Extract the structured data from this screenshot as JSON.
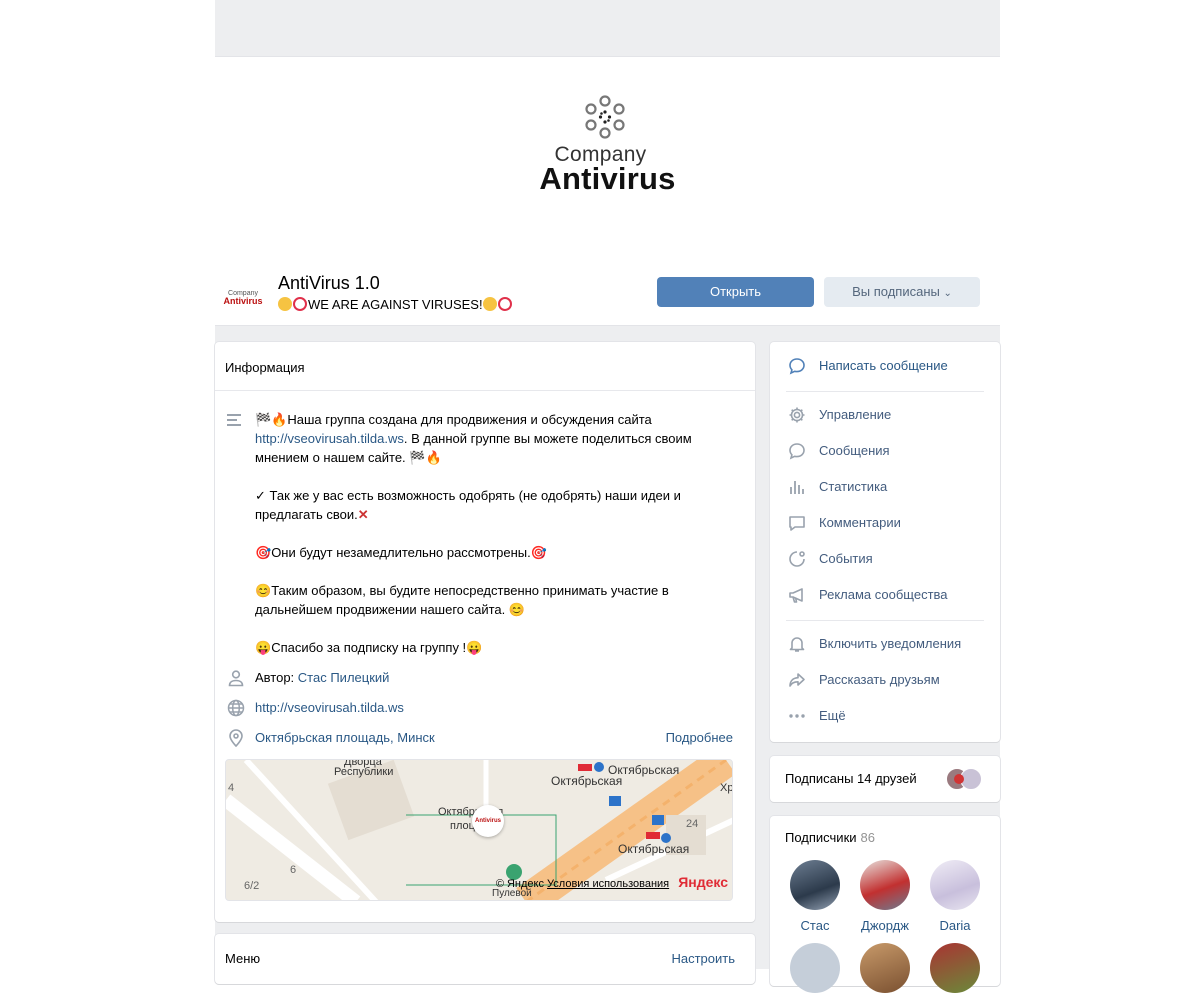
{
  "cover": {
    "company": "Company",
    "antivirus": "Antivirus"
  },
  "header": {
    "avatar_company": "Company",
    "avatar_antivirus": "Antivirus",
    "title": "AntiVirus 1.0",
    "status": "WE ARE AGAINST VIRUSES!",
    "open_button": "Открыть",
    "subscribed_button": "Вы подписаны"
  },
  "info": {
    "title": "Информация",
    "desc_line1": "Наша группа создана для продвижения и обсуждения сайта",
    "desc_link": "http://vseovirusah.tilda.ws",
    "desc_line2": ". В данной группе вы можете поделиться своим мнением о нашем сайте.",
    "desc_p2": "✓ Так же у вас есть возможность одобрять (не одобрять) наши идеи и предлагать свои.",
    "desc_p3": "Они будут незамедлительно рассмотрены.",
    "desc_p4": "Таким образом, вы будите непосредственно принимать участие в дальнейшем продвижении нашего сайта.",
    "desc_p5": "Спасибо за подписку на группу !",
    "author_label": "Автор:",
    "author_name": "Стас Пилецкий",
    "website": "http://vseovirusah.tilda.ws",
    "address": "Октябрьская площадь, Минск",
    "more": "Подробнее"
  },
  "map": {
    "labels": [
      "Дворца",
      "Республики",
      "Октябрьская",
      "Октябрьская",
      "Октябрьская",
      "плоц",
      "Октябрьская",
      "24",
      "6",
      "6/2",
      "4",
      "Хр",
      "Пулевой"
    ],
    "copyright": "© Яндекс",
    "terms": "Условия использования",
    "brand": "Яндекс"
  },
  "menu": {
    "title": "Меню",
    "configure": "Настроить"
  },
  "actions": [
    {
      "label": "Написать сообщение",
      "icon": "message-icon"
    },
    {
      "label": "Управление",
      "icon": "gear-icon"
    },
    {
      "label": "Сообщения",
      "icon": "chat-icon"
    },
    {
      "label": "Статистика",
      "icon": "stats-icon"
    },
    {
      "label": "Комментарии",
      "icon": "comment-icon"
    },
    {
      "label": "События",
      "icon": "event-icon"
    },
    {
      "label": "Реклама сообщества",
      "icon": "megaphone-icon"
    },
    {
      "label": "Включить уведомления",
      "icon": "bell-icon"
    },
    {
      "label": "Рассказать друзьям",
      "icon": "share-icon"
    },
    {
      "label": "Ещё",
      "icon": "more-icon"
    }
  ],
  "friends": {
    "label": "Подписаны 14 друзей"
  },
  "subscribers": {
    "title": "Подписчики",
    "count": "86",
    "items": [
      {
        "name": "Стас"
      },
      {
        "name": "Джордж"
      },
      {
        "name": "Daria"
      }
    ]
  },
  "colors": {
    "accent": "#5181b8",
    "link": "#2a5885",
    "page_bg": "#edeef0"
  }
}
